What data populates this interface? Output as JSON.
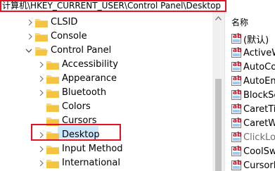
{
  "address_bar": {
    "path": "计算机\\HKEY_CURRENT_USER\\Control Panel\\Desktop"
  },
  "tree": {
    "items": [
      {
        "label": "CLSID",
        "expanded": false
      },
      {
        "label": "Console",
        "expanded": false
      },
      {
        "label": "Control Panel",
        "expanded": true
      },
      {
        "label": "Accessibility",
        "expanded": false
      },
      {
        "label": "Appearance",
        "expanded": false
      },
      {
        "label": "Bluetooth",
        "expanded": false
      },
      {
        "label": "Colors",
        "expanded": false
      },
      {
        "label": "Cursors",
        "expanded": false
      },
      {
        "label": "Desktop",
        "expanded": false,
        "selected": true
      },
      {
        "label": "Input Method",
        "expanded": false
      },
      {
        "label": "International",
        "expanded": false
      }
    ]
  },
  "values_list": {
    "header": "名称",
    "items": [
      {
        "name": "(默认)"
      },
      {
        "name": "ActiveW"
      },
      {
        "name": "AutoCol"
      },
      {
        "name": "AutoEnd"
      },
      {
        "name": "BlockSe"
      },
      {
        "name": "CaretTin"
      },
      {
        "name": "CaretWi"
      },
      {
        "name": "ClickLoc"
      },
      {
        "name": "CoolSwi"
      },
      {
        "name": "CursorB"
      }
    ],
    "icon_text": "ab"
  },
  "colors": {
    "highlight_border": "#e81123",
    "selection": "#cce8ff",
    "folder": "#f8d775"
  }
}
